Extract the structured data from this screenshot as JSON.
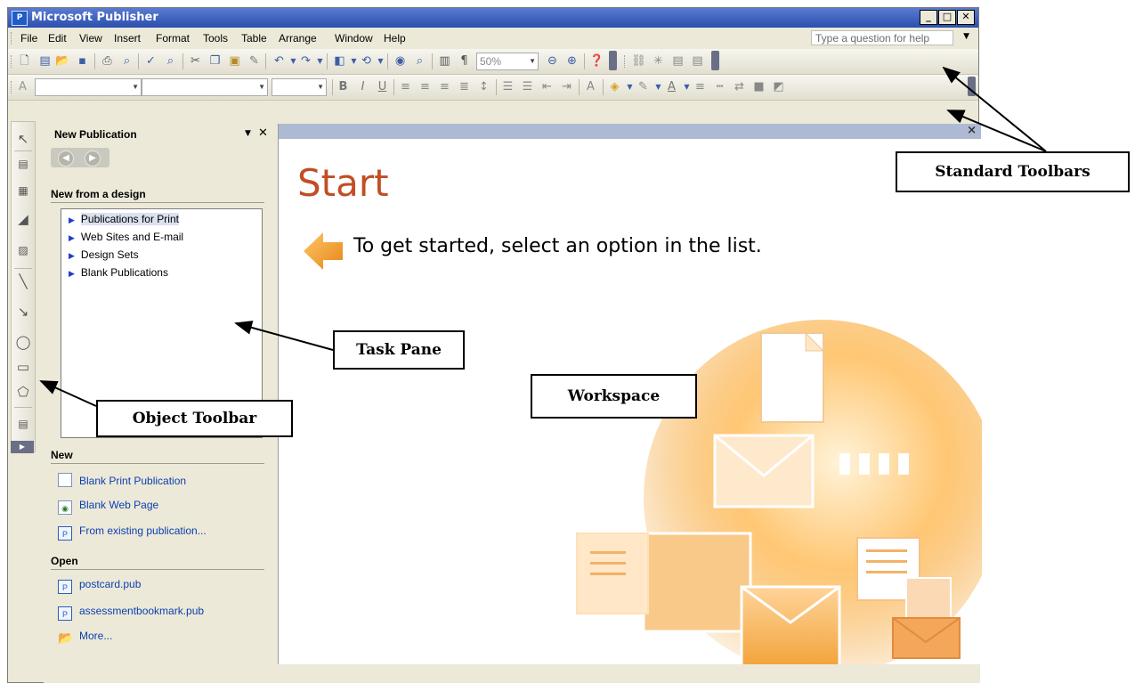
{
  "window": {
    "title": "Microsoft Publisher",
    "app_icon": "P"
  },
  "window_controls": {
    "minimize": "_",
    "maximize": "□",
    "close": "✕"
  },
  "menu": {
    "items": [
      "File",
      "Edit",
      "View",
      "Insert",
      "Format",
      "Tools",
      "Table",
      "Arrange",
      "Window",
      "Help"
    ],
    "help_placeholder": "Type a question for help"
  },
  "standard_toolbar": {
    "zoom_value": "50%"
  },
  "task_pane": {
    "title": "New Publication",
    "section_new_from_design": "New from a design",
    "design_items": [
      "Publications for Print",
      "Web Sites and E-mail",
      "Design Sets",
      "Blank Publications"
    ],
    "selected_design_item": "Publications for Print",
    "section_new": "New",
    "new_items": [
      "Blank Print Publication",
      "Blank Web Page",
      "From existing publication..."
    ],
    "section_open": "Open",
    "open_items": [
      "postcard.pub",
      "assessmentbookmark.pub",
      "More..."
    ]
  },
  "workspace": {
    "start_title": "Start",
    "instruction": "To get started, select an option in the list."
  },
  "callouts": {
    "standard_toolbars": "Standard Toolbars",
    "task_pane": "Task Pane",
    "workspace": "Workspace",
    "object_toolbar": "Object Toolbar"
  },
  "colors": {
    "title_bar": "#2a4fae",
    "start_title": "#c14e24",
    "link": "#0b3fb0",
    "workspace_header": "#aebad4",
    "chrome": "#ece9d8"
  },
  "icons": {
    "object_toolbar": [
      "pointer-icon",
      "text-box-icon",
      "table-icon",
      "wordart-icon",
      "picture-icon",
      "line-icon",
      "arrow-icon",
      "oval-icon",
      "rectangle-icon",
      "autoshapes-icon",
      "design-gallery-icon"
    ]
  }
}
